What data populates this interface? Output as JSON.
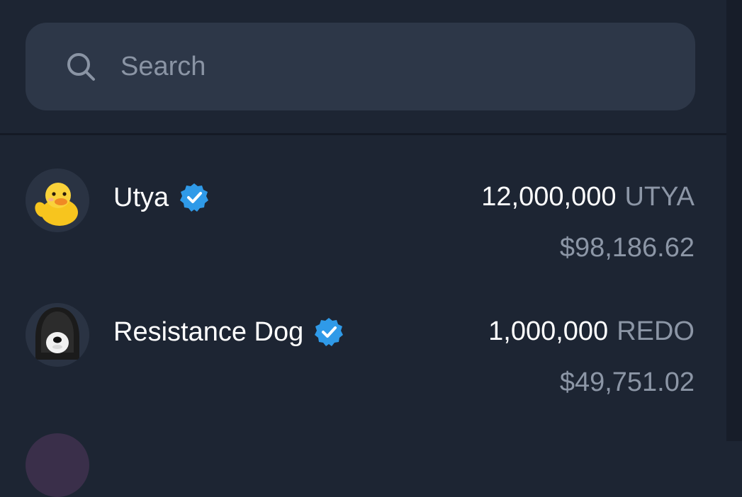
{
  "search": {
    "placeholder": "Search"
  },
  "tokens": [
    {
      "name": "Utya",
      "verified": true,
      "amount": "12,000,000",
      "ticker": "UTYA",
      "usd_value": "$98,186.62",
      "avatar_icon": "duck-icon"
    },
    {
      "name": "Resistance Dog",
      "verified": true,
      "amount": "1,000,000",
      "ticker": "REDO",
      "usd_value": "$49,751.02",
      "avatar_icon": "hooded-dog-icon"
    }
  ],
  "colors": {
    "background": "#1d2533",
    "search_background": "#2d3748",
    "verified_badge": "#2f9ae8",
    "muted_text": "#8c96a6",
    "primary_text": "#ffffff"
  }
}
